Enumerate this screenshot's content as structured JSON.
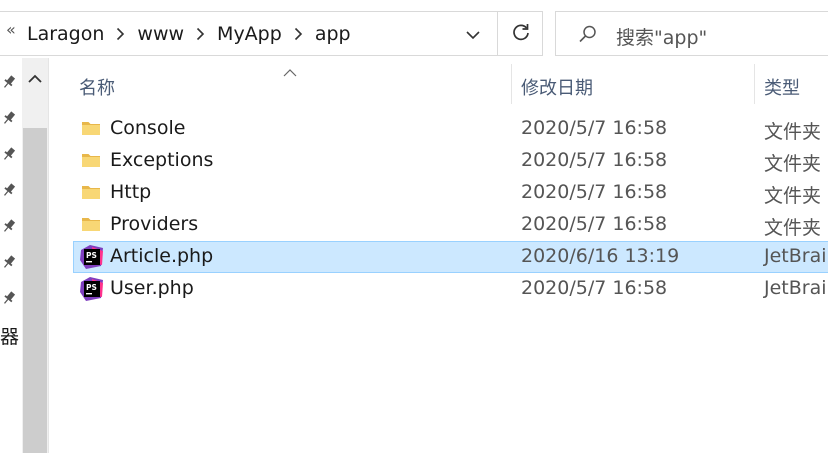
{
  "address_bar": {
    "overflow_glyph": "«",
    "crumbs": [
      "Laragon",
      "www",
      "MyApp",
      "app"
    ]
  },
  "search": {
    "placeholder": "搜索\"app\""
  },
  "left_pane": {
    "cut_text": "器"
  },
  "columns": {
    "name": "名称",
    "date": "修改日期",
    "type": "类型"
  },
  "files": [
    {
      "name": "Console",
      "date": "2020/5/7 16:58",
      "type": "文件夹",
      "kind": "folder"
    },
    {
      "name": "Exceptions",
      "date": "2020/5/7 16:58",
      "type": "文件夹",
      "kind": "folder"
    },
    {
      "name": "Http",
      "date": "2020/5/7 16:58",
      "type": "文件夹",
      "kind": "folder"
    },
    {
      "name": "Providers",
      "date": "2020/5/7 16:58",
      "type": "文件夹",
      "kind": "folder"
    },
    {
      "name": "Article.php",
      "date": "2020/6/16 13:19",
      "type": "JetBrains",
      "kind": "phpstorm-file",
      "selected": true
    },
    {
      "name": "User.php",
      "date": "2020/5/7 16:58",
      "type": "JetBrains",
      "kind": "phpstorm-file"
    }
  ],
  "icons": {
    "folder": "folder-icon",
    "phpstorm_file": "phpstorm-file-icon",
    "pin": "pin-icon",
    "refresh": "refresh-icon",
    "search": "search-icon"
  },
  "colors": {
    "selection_bg": "#cce8ff",
    "selection_border": "#99d1ff",
    "folder": "#f8d775",
    "header_text": "#4a5b76"
  }
}
